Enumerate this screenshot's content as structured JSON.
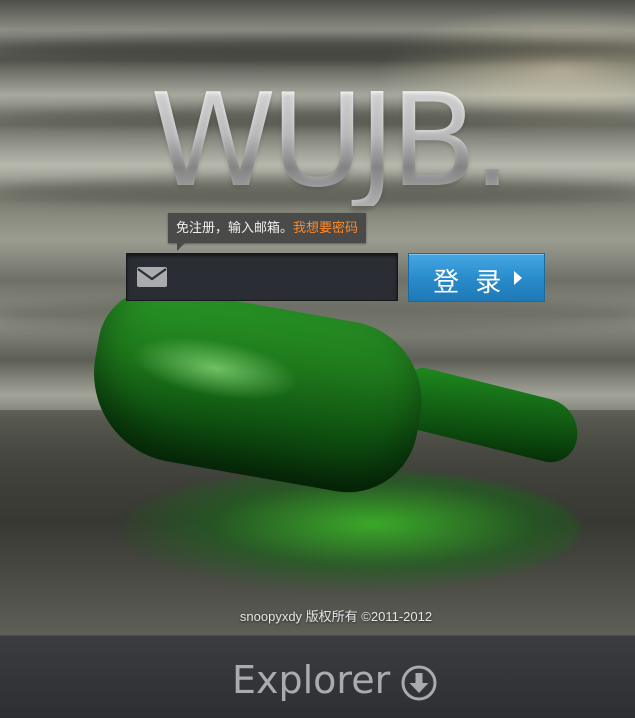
{
  "logo": {
    "text": "WUJB."
  },
  "tooltip": {
    "text": "免注册，输入邮箱。",
    "link_label": "我想要密码"
  },
  "login_form": {
    "email_value": "",
    "email_placeholder": "",
    "submit_label": "登 录"
  },
  "footer": {
    "copyright": "snoopyxdy 版权所有 ©2011-2012"
  },
  "explorer": {
    "label": "Explorer"
  },
  "icons": {
    "email": "mail-envelope-icon",
    "submit_arrow": "caret-right-icon",
    "explorer": "circle-arrow-down-icon"
  },
  "colors": {
    "login_button": "#2a8ccc",
    "link_accent": "#ff8a2a",
    "input_background": "#2a2d33",
    "explorer_bar": "#2d2f32"
  }
}
